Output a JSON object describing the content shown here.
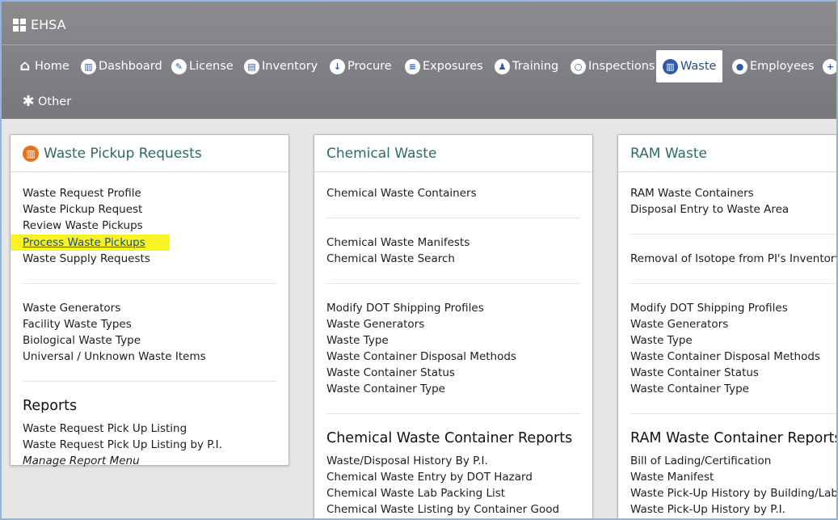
{
  "app": {
    "title": "EHSA"
  },
  "nav": {
    "items": [
      {
        "label": "Home",
        "icon": "home-icon",
        "glyph": "⌂",
        "active": false
      },
      {
        "label": "Dashboard",
        "icon": "dashboard-icon",
        "glyph": "▥",
        "active": false
      },
      {
        "label": "License",
        "icon": "wrench-icon",
        "glyph": "✎",
        "active": false
      },
      {
        "label": "Inventory",
        "icon": "inventory-icon",
        "glyph": "▤",
        "active": false
      },
      {
        "label": "Procure",
        "icon": "download-icon",
        "glyph": "↓",
        "active": false
      },
      {
        "label": "Exposures",
        "icon": "clipboard-icon",
        "glyph": "≡",
        "active": false
      },
      {
        "label": "Training",
        "icon": "training-icon",
        "glyph": "♟",
        "active": false
      },
      {
        "label": "Inspections",
        "icon": "search-icon",
        "glyph": "○",
        "active": false
      },
      {
        "label": "Waste",
        "icon": "trash-icon",
        "glyph": "▥",
        "active": true
      },
      {
        "label": "Employees",
        "icon": "employees-icon",
        "glyph": "●",
        "active": false
      },
      {
        "label": "",
        "icon": "plus-icon",
        "glyph": "+",
        "active": false
      },
      {
        "label": "Other",
        "icon": "asterisk-icon",
        "glyph": "✱",
        "active": false
      }
    ]
  },
  "panels": {
    "pickup": {
      "title": "Waste Pickup Requests",
      "group1": [
        "Waste Request Profile",
        "Waste Pickup Request",
        "Review Waste Pickups",
        "Process Waste Pickups",
        "Waste Supply Requests"
      ],
      "group2": [
        "Waste Generators",
        "Facility Waste Types",
        "Biological Waste Type",
        "Universal / Unknown Waste Items"
      ],
      "reports_title": "Reports",
      "reports": [
        "Waste Request Pick Up Listing",
        "Waste Request Pick Up Listing by P.I."
      ],
      "manage": "Manage Report Menu"
    },
    "chemical": {
      "title": "Chemical Waste",
      "group1": [
        "Chemical Waste Containers"
      ],
      "group2": [
        "Chemical Waste Manifests",
        "Chemical Waste Search"
      ],
      "group3": [
        "Modify DOT Shipping Profiles",
        "Waste Generators",
        "Waste Type",
        "Waste Container Disposal Methods",
        "Waste Container Status",
        "Waste Container Type"
      ],
      "reports_title": "Chemical Waste Container Reports",
      "reports": [
        "Waste/Disposal History By P.I.",
        "Chemical Waste Entry by DOT Hazard",
        "Chemical Waste Lab Packing List",
        "Chemical Waste Listing by Container Good"
      ]
    },
    "ram": {
      "title": "RAM Waste",
      "group1": [
        "RAM Waste Containers",
        "Disposal Entry to Waste Area"
      ],
      "group2": [
        "Removal of Isotope from PI's Inventory"
      ],
      "group3": [
        "Modify DOT Shipping Profiles",
        "Waste Generators",
        "Waste Type",
        "Waste Container Disposal Methods",
        "Waste Container Status",
        "Waste Container Type"
      ],
      "reports_title": "RAM Waste Container Reports",
      "reports": [
        "Bill of Lading/Certification",
        "Waste Manifest",
        "Waste Pick-Up History by Building/Lab",
        "Waste Pick-Up History by P.I."
      ]
    }
  }
}
